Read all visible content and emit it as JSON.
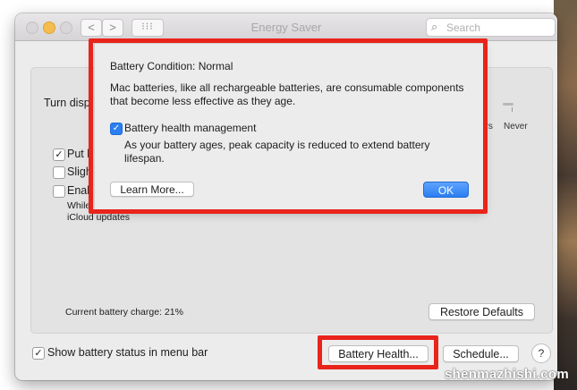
{
  "window": {
    "title": "Energy Saver",
    "search_placeholder": "Search",
    "nav_back": "<",
    "nav_forward": ">",
    "grid_glyph": "⁝⁝⁝"
  },
  "panel": {
    "turn_display_label": "Turn disp",
    "tick_hrs": "nrs",
    "tick_never": "Never",
    "options": [
      {
        "label": "Put h",
        "checked": true
      },
      {
        "label": "Sligh",
        "checked": false
      },
      {
        "label": "Enab",
        "checked": false
      }
    ],
    "note_line1": "While",
    "note_line2": "iCloud updates",
    "current_charge": "Current battery charge: 21%",
    "restore_defaults": "Restore Defaults"
  },
  "footer": {
    "show_status_label": "Show battery status in menu bar",
    "show_status_checked": true,
    "battery_health_button": "Battery Health...",
    "schedule_button": "Schedule...",
    "help_button": "?"
  },
  "sheet": {
    "condition": "Battery Condition:  Normal",
    "description": "Mac batteries, like all rechargeable batteries, are consumable components that become less effective as they age.",
    "health_management_label": "Battery health management",
    "health_management_checked": true,
    "health_management_desc": "As your battery ages, peak capacity is reduced to extend battery lifespan.",
    "learn_more": "Learn More...",
    "ok": "OK"
  },
  "icons": {
    "search": "search-icon",
    "checkmark": "checkmark-icon",
    "help": "help-icon"
  },
  "colors": {
    "highlight": "#e9241b",
    "accent": "#2b7ff0"
  },
  "watermark": "shenmazhishi.com"
}
